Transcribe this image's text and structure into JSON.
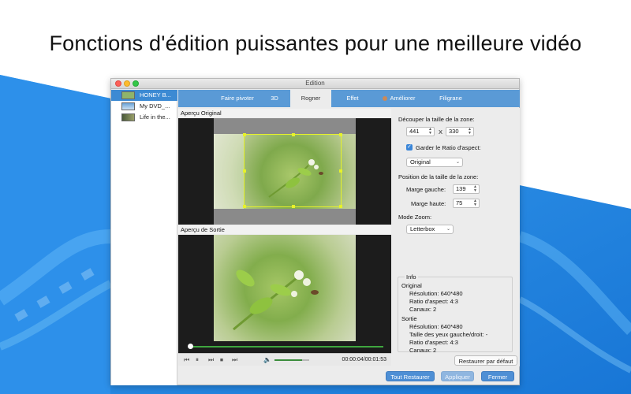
{
  "headline": "Fonctions d'édition puissantes pour une meilleure vidéo",
  "window": {
    "title": "Edition"
  },
  "files": [
    {
      "label": "HONEY B...",
      "selected": true
    },
    {
      "label": "My DVD_...",
      "selected": false
    },
    {
      "label": "Life in the...",
      "selected": false
    }
  ],
  "tabs": [
    {
      "label": "Faire pivoter"
    },
    {
      "label": "3D"
    },
    {
      "label": "Rogner",
      "active": true
    },
    {
      "label": "Effet"
    },
    {
      "label": "Améliorer"
    },
    {
      "label": "Filigrane"
    }
  ],
  "preview": {
    "original_label": "Aperçu Original",
    "output_label": "Aperçu de Sortie"
  },
  "player": {
    "time": "00:00:04/00:01:53",
    "volume": 0.8,
    "progress": 0.02
  },
  "crop": {
    "size_label": "Découper la taille de la zone:",
    "width": "441",
    "separator": "X",
    "height": "330",
    "keep_ratio_label": "Garder le Ratio d'aspect:",
    "keep_ratio_checked": true,
    "ratio_value": "Original",
    "position_label": "Position de la taille de la zone:",
    "margin_left_label": "Marge gauche:",
    "margin_left": "139",
    "margin_top_label": "Marge haute:",
    "margin_top": "75",
    "zoom_label": "Mode Zoom:",
    "zoom_value": "Letterbox"
  },
  "info": {
    "title": "Info",
    "original_heading": "Original",
    "original_resolution": "Résolution: 640*480",
    "original_ratio": "Ratio d'aspect: 4:3",
    "original_channels": "Canaux: 2",
    "output_heading": "Sortie",
    "output_resolution": "Résolution: 640*480",
    "output_eye": "Taille des yeux gauche/droit: -",
    "output_ratio": "Ratio d'aspect: 4:3",
    "output_channels": "Canaux: 2"
  },
  "buttons": {
    "reset_default": "Restaurer par défaut",
    "reset_all": "Tout Restaurer",
    "apply": "Appliquer",
    "close": "Fermer"
  },
  "colors": {
    "accent_blue": "#5a9ad6",
    "crop_yellow": "#e6f22a",
    "background_blue": "#2a8ee8"
  }
}
